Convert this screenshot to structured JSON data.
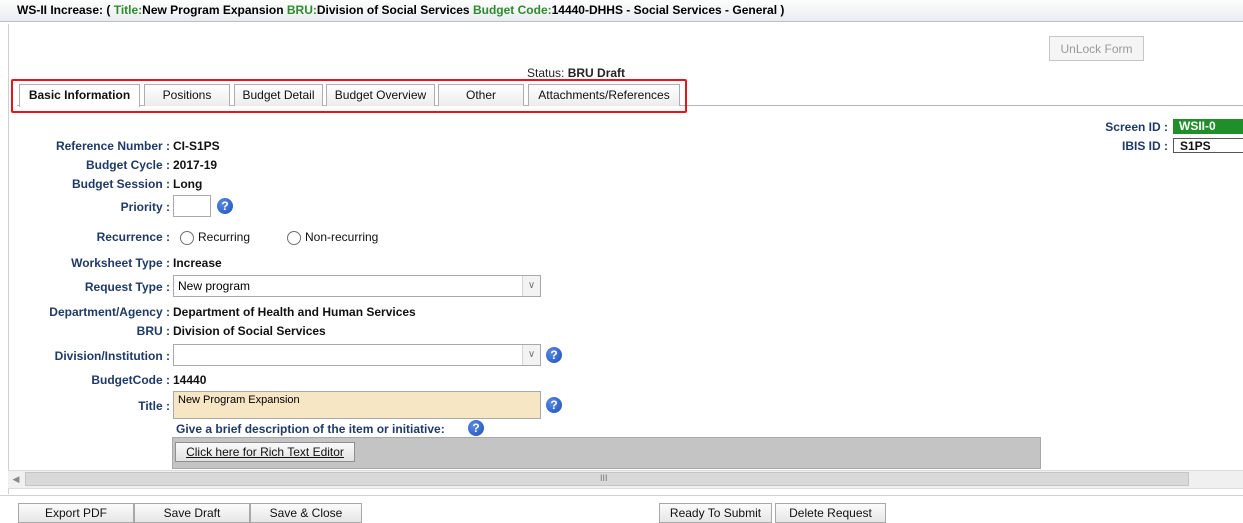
{
  "window": {
    "prefix": "WS-II Increase: (",
    "title_key": "Title:",
    "title_value": "New Program Expansion",
    "bru_key": "BRU:",
    "bru_value": "Division of Social Services",
    "budget_key": "Budget Code:",
    "budget_value": "14440-DHHS - Social Services - General )"
  },
  "toolbar": {
    "unlock_label": "UnLock Form"
  },
  "status": {
    "label": "Status:",
    "value": "BRU Draft"
  },
  "tabs": [
    {
      "label": "Basic Information"
    },
    {
      "label": "Positions"
    },
    {
      "label": "Budget Detail"
    },
    {
      "label": "Budget Overview"
    },
    {
      "label": "Other"
    },
    {
      "label": "Attachments/References"
    }
  ],
  "ids": {
    "screen_label": "Screen ID :",
    "screen_value": "WSII-0",
    "ibis_label": "IBIS ID :",
    "ibis_value": "S1PS",
    "screen_color": "#1f8f2a"
  },
  "form": {
    "reference_number": {
      "label": "Reference Number :",
      "value": "CI-S1PS"
    },
    "budget_cycle": {
      "label": "Budget Cycle :",
      "value": "2017-19"
    },
    "budget_session": {
      "label": "Budget Session :",
      "value": "Long"
    },
    "priority": {
      "label": "Priority :",
      "value": ""
    },
    "recurrence": {
      "label": "Recurrence :",
      "option1": "Recurring",
      "option2": "Non-recurring"
    },
    "worksheet_type": {
      "label": "Worksheet Type :",
      "value": "Increase"
    },
    "request_type": {
      "label": "Request Type :",
      "value": "New program"
    },
    "department": {
      "label": "Department/Agency :",
      "value": "Department of Health and Human Services"
    },
    "bru": {
      "label": "BRU :",
      "value": "Division of Social Services"
    },
    "division": {
      "label": "Division/Institution :",
      "value": ""
    },
    "budget_code": {
      "label": "BudgetCode :",
      "value": "14440"
    },
    "title": {
      "label": "Title :",
      "value": "New Program Expansion"
    },
    "description_prompt": "Give a brief description of the item or initiative:",
    "rich_text_button": "Click here for Rich Text Editor"
  },
  "footer": {
    "export_pdf": "Export PDF",
    "save_draft": "Save Draft",
    "save_close": "Save & Close",
    "ready_submit": "Ready To Submit",
    "delete_request": "Delete Request"
  },
  "colors": {
    "accent_green": "#2e8b2e",
    "label_blue": "#1f3a66",
    "title_field_bg": "#f7e6c4",
    "highlight_red": "#e8141c"
  },
  "icons": {
    "help": "help-icon",
    "dropdown": "chevron-down-icon",
    "scroll_left": "scroll-left-arrow-icon"
  }
}
